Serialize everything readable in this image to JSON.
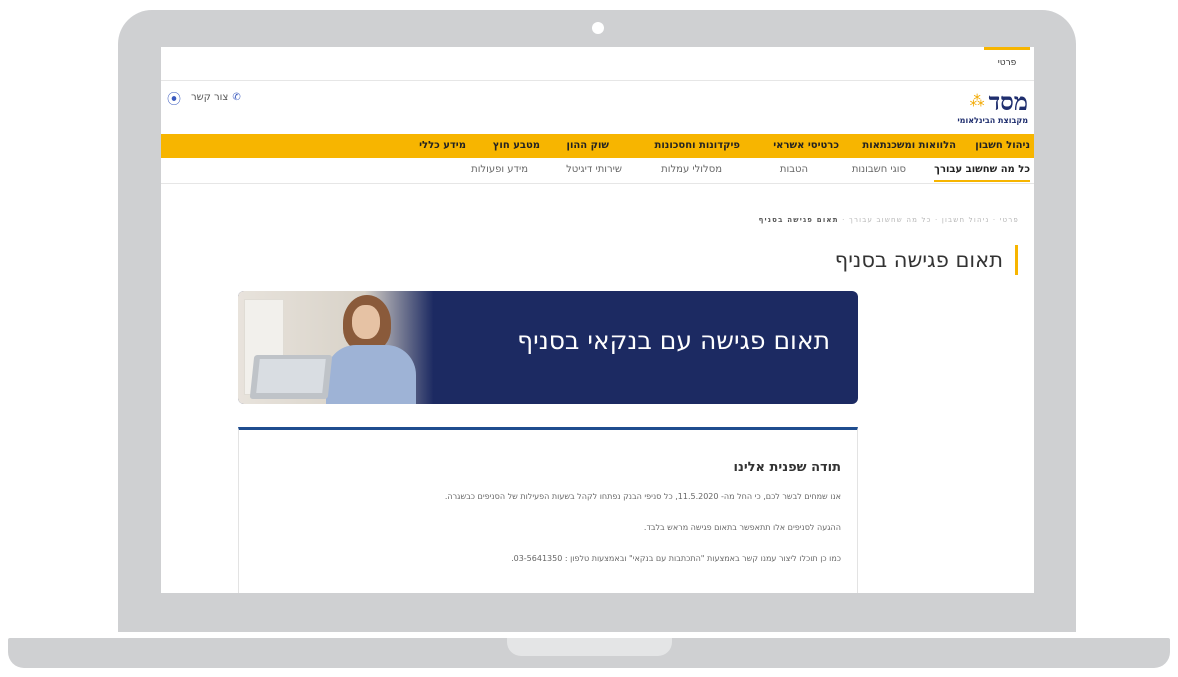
{
  "top_tab": {
    "label": "פרטי"
  },
  "logo": {
    "main": "מסד",
    "sub": "מקבוצת הבינלאומי"
  },
  "contact": {
    "label": "צור קשר"
  },
  "main_nav": [
    {
      "label": "ניהול חשבון"
    },
    {
      "label": "הלוואות ומשכנתאות"
    },
    {
      "label": "כרטיסי אשראי"
    },
    {
      "label": "פיקדונות וחסכונות"
    },
    {
      "label": "שוק ההון"
    },
    {
      "label": "מטבע חוץ"
    },
    {
      "label": "מידע כללי"
    }
  ],
  "sub_nav": [
    {
      "label": "כל מה שחשוב עבורך",
      "active": true
    },
    {
      "label": "סוגי חשבונות"
    },
    {
      "label": "הטבות"
    },
    {
      "label": "מסלולי עמלות"
    },
    {
      "label": "שירותי דיגיטל"
    },
    {
      "label": "מידע ופעולות"
    }
  ],
  "breadcrumb": {
    "trail": "פרטי · ניהול חשבון · כל מה שחשוב עבורך ·",
    "current": "תאום פגישה בסניף"
  },
  "page_title": "תאום פגישה בסניף",
  "banner": {
    "text": "תאום פגישה עם בנקאי בסניף"
  },
  "card": {
    "title": "תודה שפנית אלינו",
    "p1": "אנו שמחים לבשר לכם, כי החל מה- 11.5.2020, כל סניפי הבנק נפתחו לקהל בשעות הפעילות של הסניפים כבשגרה.",
    "p2": "ההגעה לסניפים אלו תתאפשר בתאום פגישה מראש בלבד.",
    "p3": "כמו כן תוכלו ליצור עמנו קשר באמצעות \"התכתבות עם בנקאי\" ובאמצעות טלפון : 03-5641350."
  },
  "colors": {
    "accent": "#f7b500",
    "brand_navy": "#1c2a62",
    "card_top": "#1f4d8f"
  }
}
